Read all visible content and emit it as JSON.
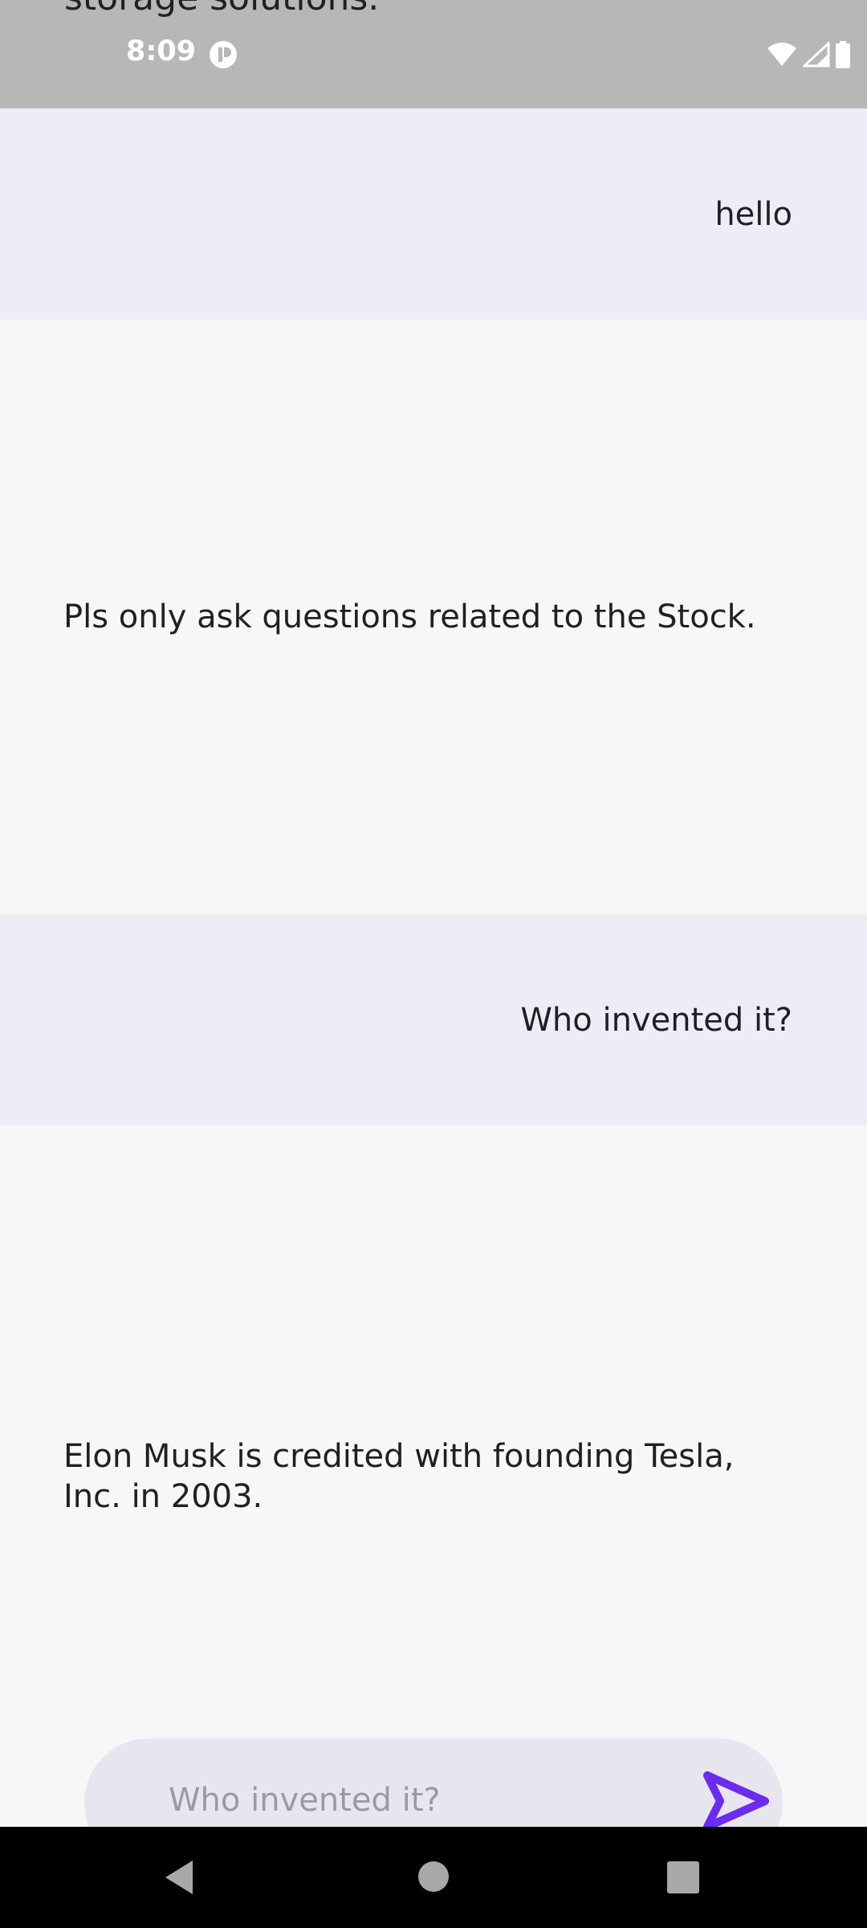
{
  "status_bar": {
    "clipped_previous_text": "storage solutions.",
    "time": "8:09",
    "app_icon": "circle-p-icon",
    "icons": [
      "wifi-icon",
      "signal-icon",
      "battery-icon"
    ]
  },
  "messages": [
    {
      "role": "user",
      "text": "hello"
    },
    {
      "role": "assistant",
      "text": "Pls only ask questions related to the Stock."
    },
    {
      "role": "user",
      "text": "Who invented it?"
    },
    {
      "role": "assistant",
      "text": "Elon Musk is credited with founding Tesla, Inc. in 2003."
    }
  ],
  "input": {
    "value": "Who invented it?",
    "send_icon": "send-icon"
  },
  "nav": {
    "back_icon": "back-triangle-icon",
    "home_icon": "home-circle-icon",
    "recents_icon": "recents-square-icon"
  },
  "colors": {
    "user_bubble": "#eeedf7",
    "assistant_bubble": "#f7f7f7",
    "accent": "#6b2bf0"
  }
}
